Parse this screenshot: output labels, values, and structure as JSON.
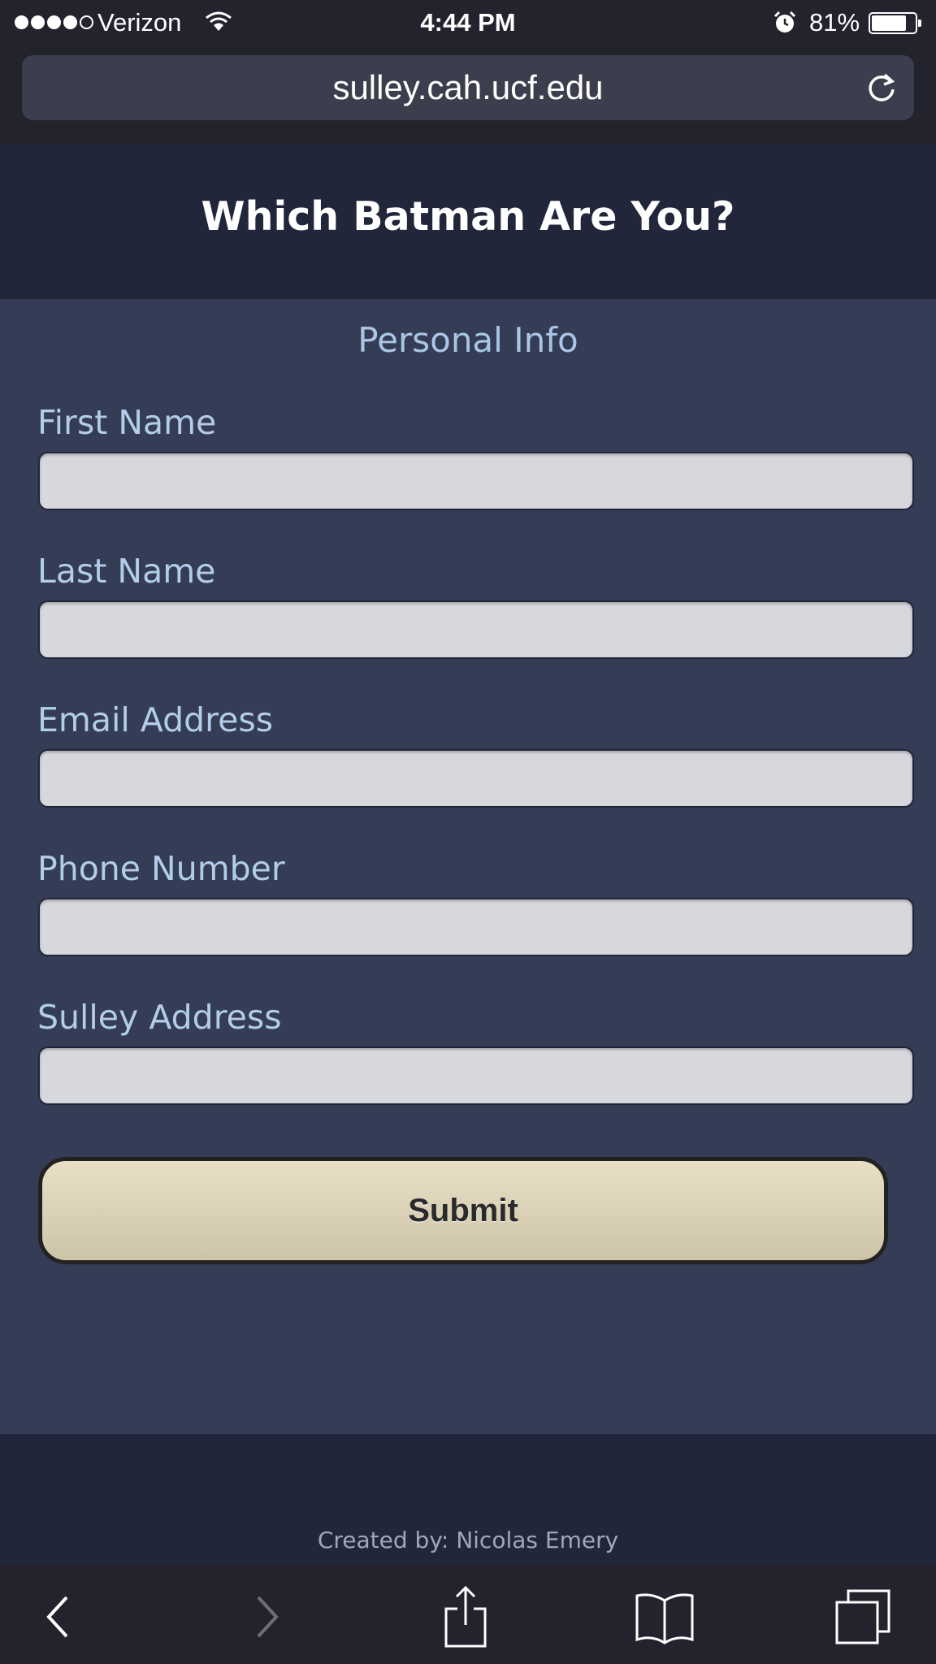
{
  "status_bar": {
    "carrier": "Verizon",
    "time": "4:44 PM",
    "battery_percent": "81%",
    "battery_level": 0.81,
    "signal_bars_filled": 4,
    "signal_bars_total": 5
  },
  "browser": {
    "url": "sulley.cah.ucf.edu",
    "reload_icon": "reload-icon"
  },
  "page": {
    "title": "Which Batman Are You?",
    "section_title": "Personal Info",
    "fields": [
      {
        "label": "First Name",
        "value": ""
      },
      {
        "label": "Last Name",
        "value": ""
      },
      {
        "label": "Email Address",
        "value": ""
      },
      {
        "label": "Phone Number",
        "value": ""
      },
      {
        "label": "Sulley Address",
        "value": ""
      }
    ],
    "submit_label": "Submit",
    "credit": "Created by: Nicolas Emery"
  },
  "toolbar": {
    "icons": [
      "back-icon",
      "forward-icon",
      "share-icon",
      "bookmarks-icon",
      "tabs-icon"
    ]
  },
  "colors": {
    "form_background": "#353c55",
    "header_background": "#22263a",
    "label_color": "#b2cde8",
    "button_color": "#e2d9be"
  }
}
